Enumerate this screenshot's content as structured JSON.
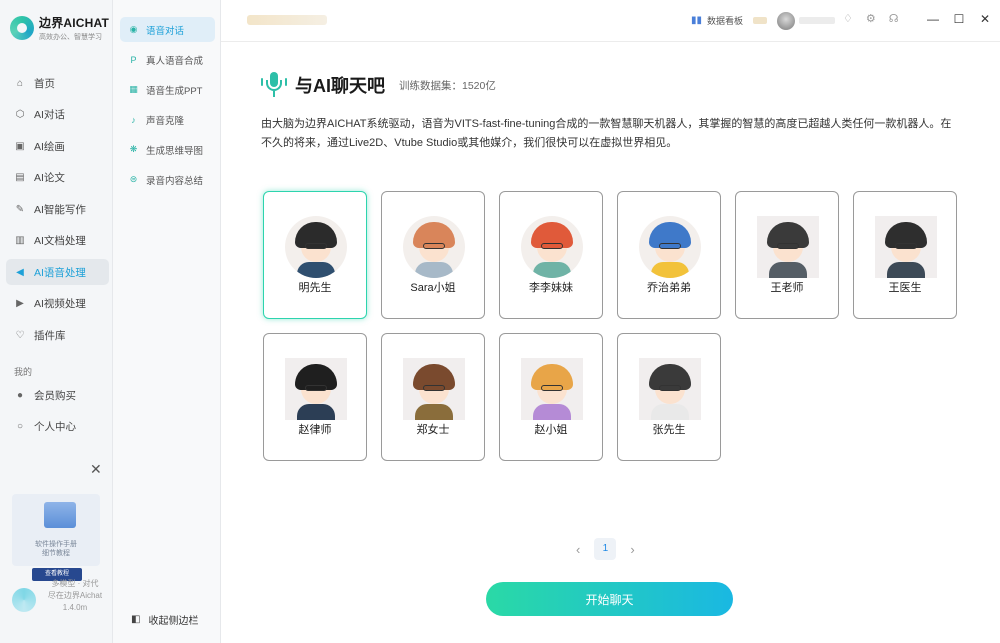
{
  "app": {
    "name": "边界AICHAT",
    "tagline": "高效办公、智慧学习"
  },
  "sidebar": {
    "items": [
      {
        "label": "首页",
        "icon": "home-icon"
      },
      {
        "label": "AI对话",
        "icon": "cube-icon"
      },
      {
        "label": "AI绘画",
        "icon": "image-icon"
      },
      {
        "label": "AI论文",
        "icon": "document-icon"
      },
      {
        "label": "AI智能写作",
        "icon": "pen-icon"
      },
      {
        "label": "AI文档处理",
        "icon": "text-doc-icon"
      },
      {
        "label": "AI语音处理",
        "icon": "speaker-icon",
        "active": true
      },
      {
        "label": "AI视频处理",
        "icon": "video-icon"
      },
      {
        "label": "插件库",
        "icon": "plugin-icon"
      }
    ],
    "section_label": "我的",
    "account_items": [
      {
        "label": "会员购买",
        "icon": "user-icon"
      },
      {
        "label": "个人中心",
        "icon": "person-icon"
      }
    ],
    "promo": {
      "text_line1": "软件操作手册",
      "text_line2": "细节教程",
      "button": "查看教程",
      "close": "✕"
    },
    "version": {
      "line1": "多模型 · 对代",
      "line2": "尽在边界Aichat",
      "line3": "1.4.0m"
    }
  },
  "subbar": {
    "items": [
      {
        "label": "语音对话",
        "icon": "voice-chat-icon",
        "active": true
      },
      {
        "label": "真人语音合成",
        "icon": "p-badge-icon"
      },
      {
        "label": "语音生成PPT",
        "icon": "slides-icon"
      },
      {
        "label": "声音克隆",
        "icon": "clone-icon"
      },
      {
        "label": "生成思维导图",
        "icon": "mindmap-icon"
      },
      {
        "label": "录音内容总结",
        "icon": "record-icon"
      }
    ],
    "collapse_label": "收起侧边栏"
  },
  "topbar": {
    "dashboard_label": "数据看板"
  },
  "main": {
    "title": "与AI聊天吧",
    "dataset": "训练数据集：1520亿",
    "intro": "由大脑为边界AICHAT系统驱动，语音为VITS-fast-fine-tuning合成的一款智慧聊天机器人，其掌握的智慧的高度已超越人类任何一款机器人。在不久的将来，通过Live2D、Vtube Studio或其他媒介，我们很快可以在虚拟世界相见。",
    "characters": [
      {
        "name": "明先生",
        "selected": true,
        "hair": "#2b2b2b",
        "body": "#2f4f6f"
      },
      {
        "name": "Sara小姐",
        "hair": "#d9855a",
        "body": "#a7b9c8"
      },
      {
        "name": "李李妹妹",
        "hair": "#e05a3a",
        "body": "#6fb3a6"
      },
      {
        "name": "乔治弟弟",
        "hair": "#3f79c9",
        "body": "#f2c23a"
      },
      {
        "name": "王老师",
        "hair": "#3a3a3a",
        "body": "#555e66"
      },
      {
        "name": "王医生",
        "hair": "#2e2e2e",
        "body": "#3d4a57"
      },
      {
        "name": "赵律师",
        "hair": "#1f1f1f",
        "body": "#2c3e55"
      },
      {
        "name": "郑女士",
        "hair": "#7a4a2e",
        "body": "#8a6d3b"
      },
      {
        "name": "赵小姐",
        "hair": "#e8a548",
        "body": "#b58bd6"
      },
      {
        "name": "张先生",
        "hair": "#3a3a3a",
        "body": "#e9e9e9"
      }
    ],
    "pagination": {
      "prev": "‹",
      "current": "1",
      "next": "›"
    },
    "start_button": "开始聊天"
  }
}
